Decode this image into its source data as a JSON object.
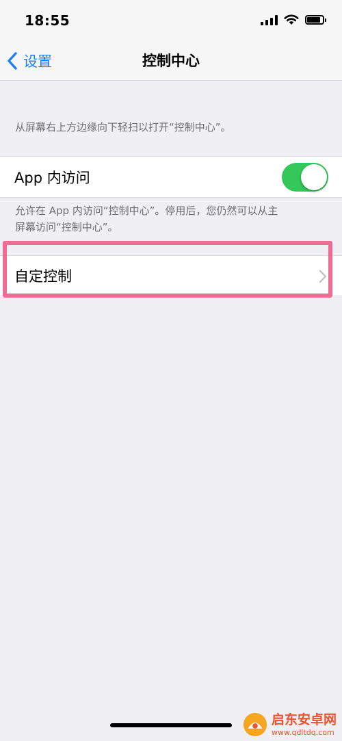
{
  "status_bar": {
    "time": "18:55",
    "battery_level": 0.85,
    "icons": [
      "signal-icon",
      "wifi-icon",
      "battery-icon"
    ]
  },
  "nav": {
    "back_label": "设置",
    "title": "控制中心"
  },
  "swipe_hint": "从屏幕右上方边缘向下轻扫以打开“控制中心”。",
  "app_access": {
    "label": "App 内访问",
    "enabled": true,
    "description_line1": "允许在 App 内访问“控制中心”。停用后，您仍然可以从主",
    "description_line2": "屏幕访问“控制中心”。"
  },
  "customize": {
    "label": "自定控制"
  },
  "watermark": {
    "name": "启东安卓网",
    "url": "www.qdltdq.com"
  },
  "colors": {
    "accent": "#1f7ef4",
    "toggle_on": "#34c759",
    "highlight": "#ef6d94",
    "background": "#efeff4",
    "watermark": "#e8552f"
  }
}
